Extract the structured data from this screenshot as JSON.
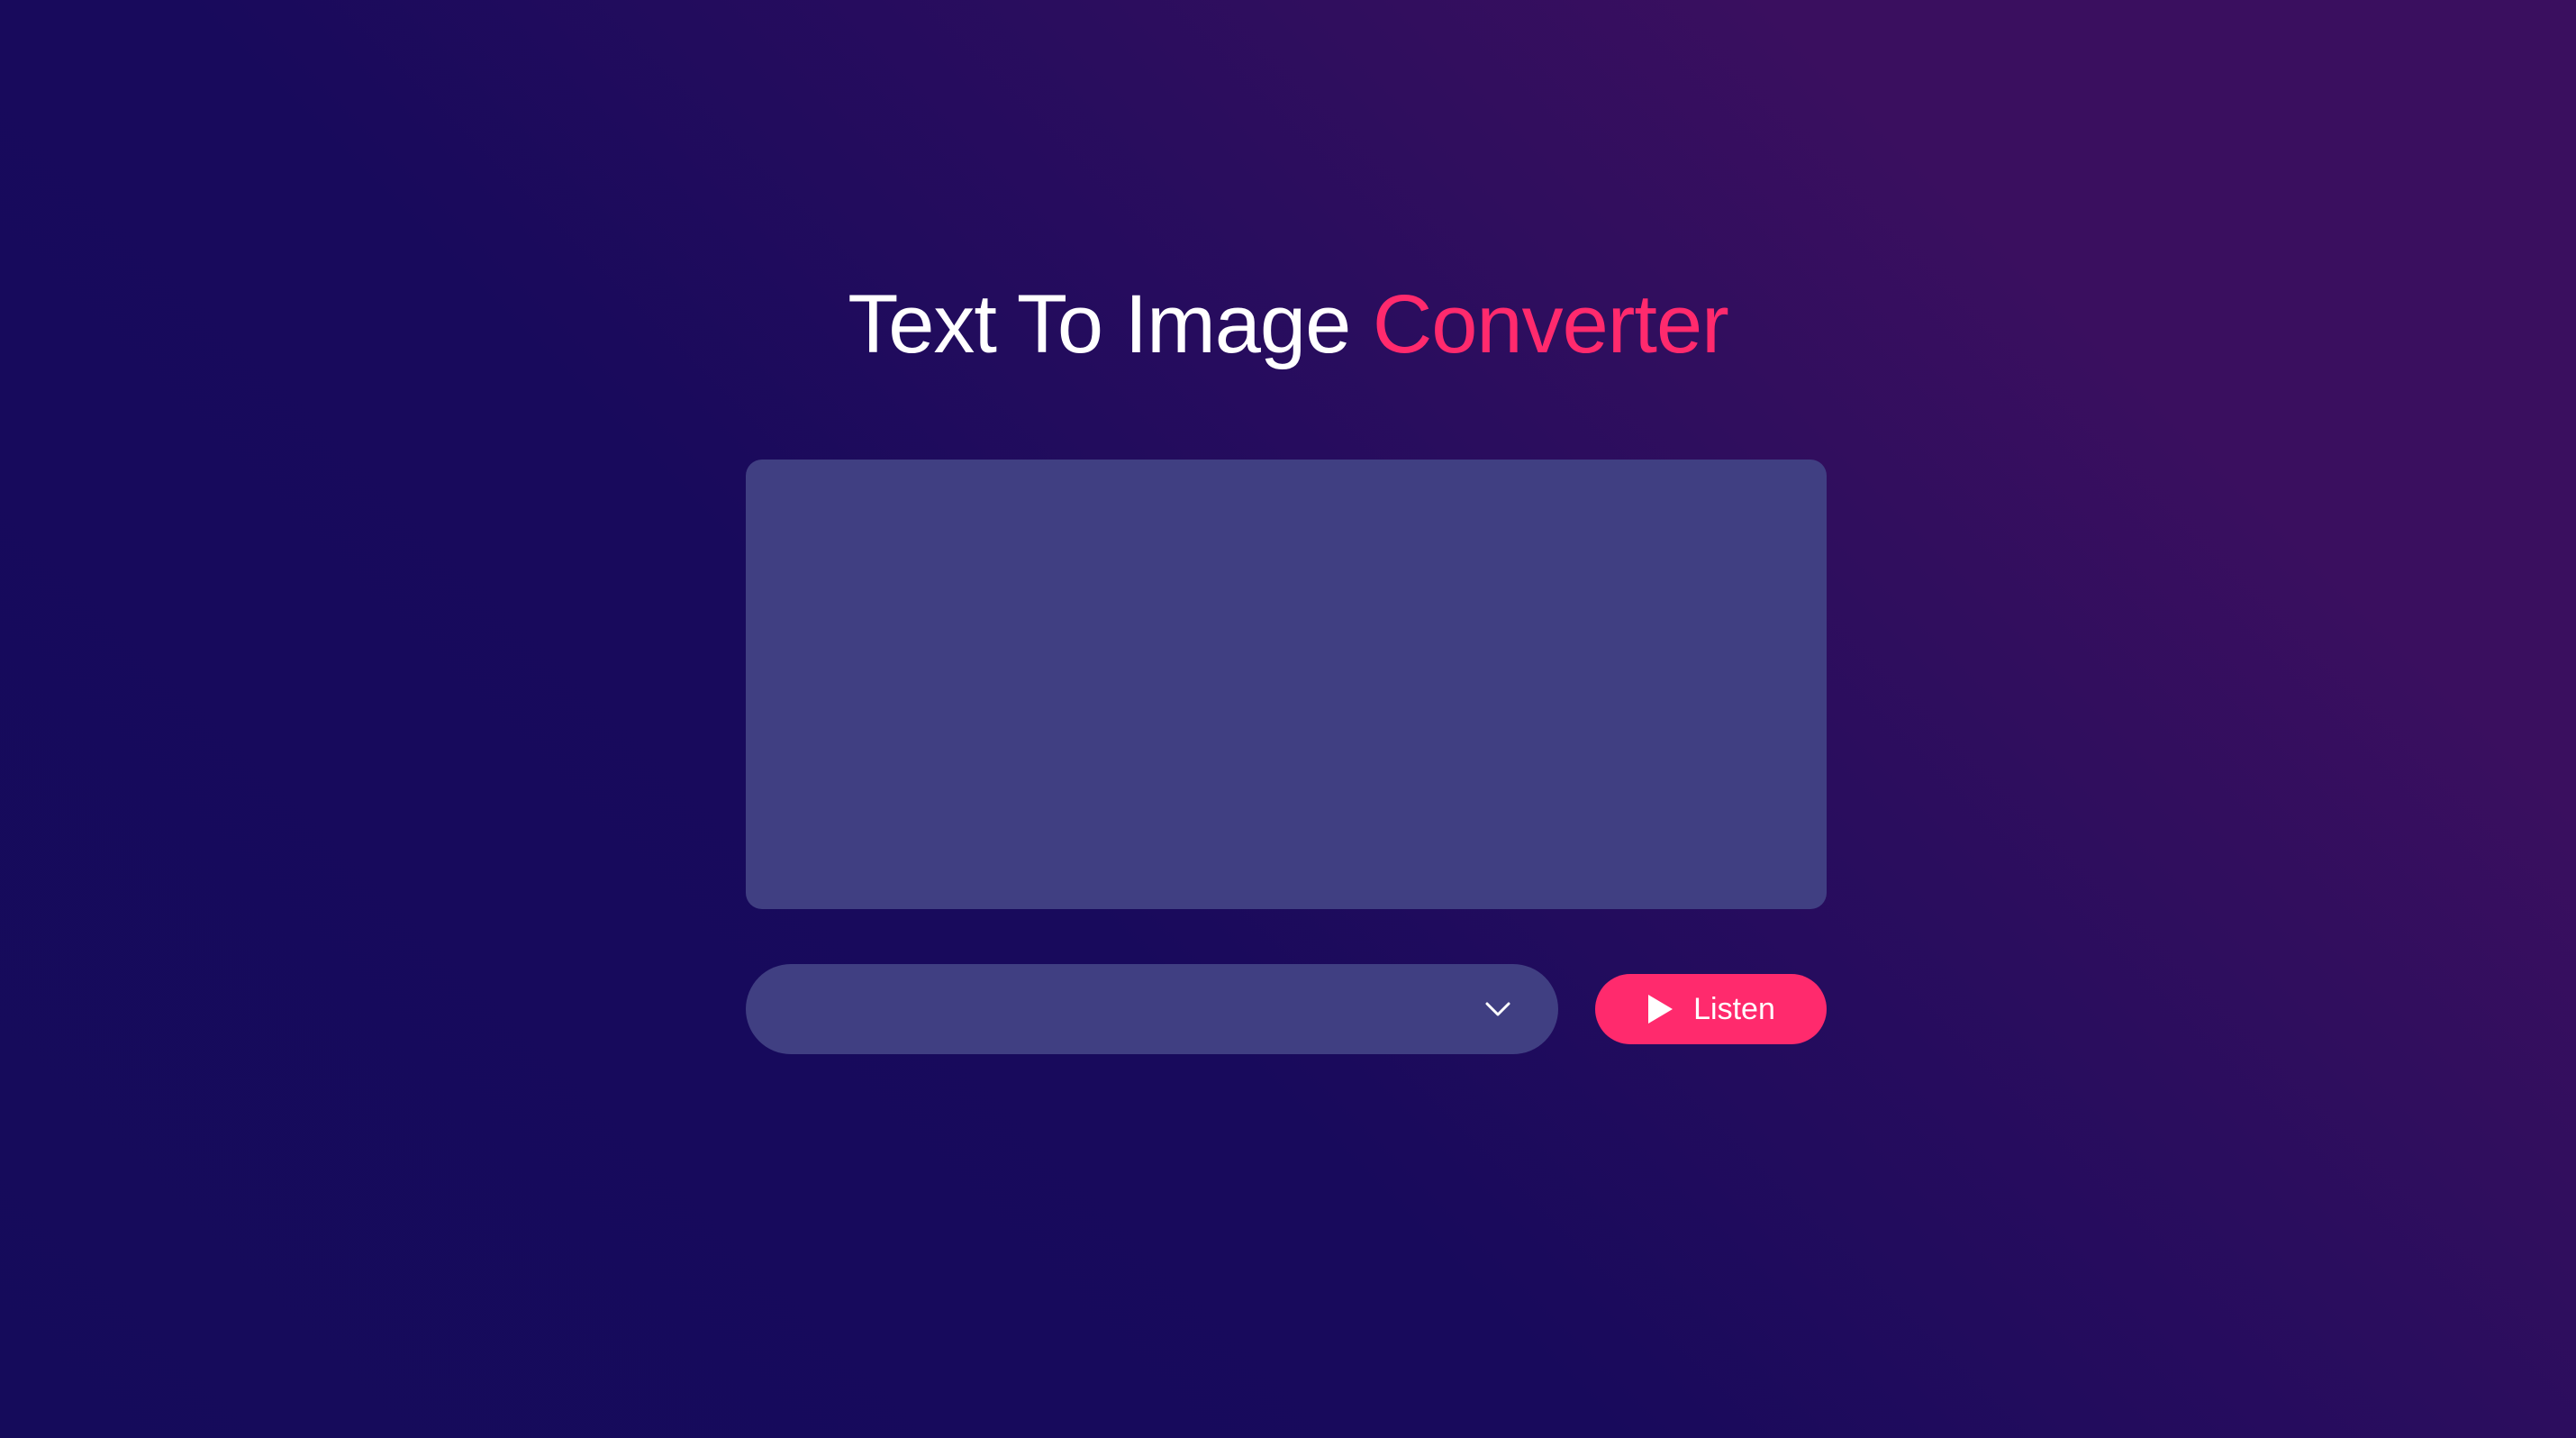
{
  "header": {
    "title_part1": "Text To Image ",
    "title_accent": "Converter"
  },
  "text_input": {
    "value": "",
    "placeholder": ""
  },
  "voice_select": {
    "selected": "",
    "icon": "chevron-down-icon"
  },
  "listen_button": {
    "label": "Listen",
    "icon": "play-icon"
  },
  "colors": {
    "accent": "#ff2a6d",
    "panel": "#403f82",
    "background_start": "#150b5b",
    "background_end": "#3a0f5f",
    "text": "#ffffff"
  }
}
